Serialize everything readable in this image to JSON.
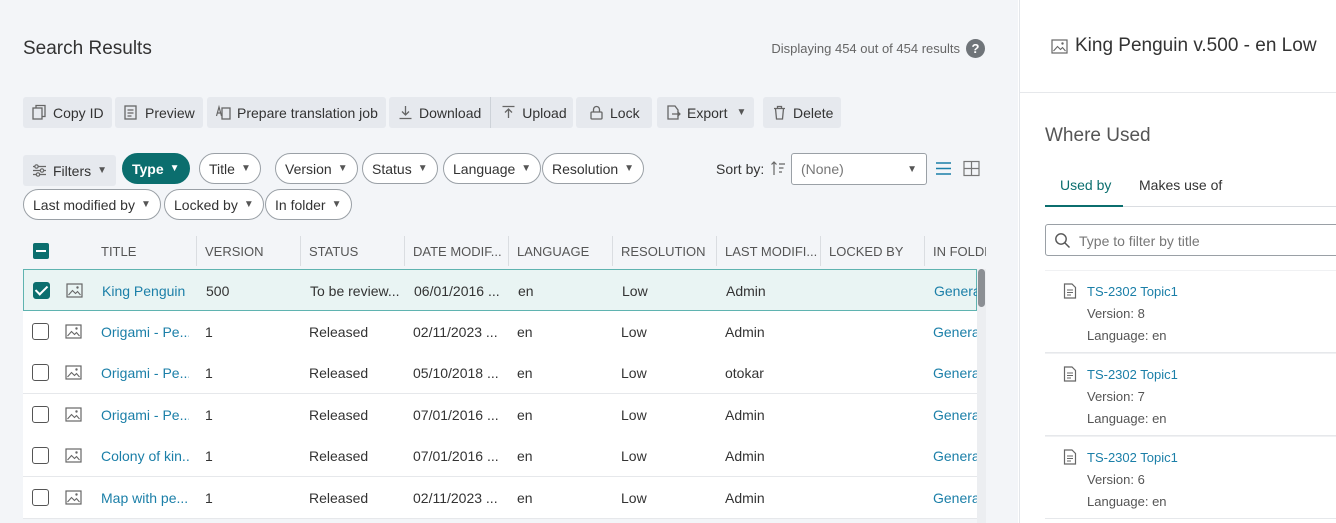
{
  "search": {
    "title": "Search Results",
    "displaying": "Displaying 454 out of 454 results",
    "help": "?"
  },
  "toolbar": {
    "copy_id": "Copy ID",
    "preview": "Preview",
    "prepare_translation": "Prepare translation job",
    "download": "Download",
    "upload": "Upload",
    "lock": "Lock",
    "export": "Export",
    "delete": "Delete"
  },
  "filters": {
    "filters_label": "Filters",
    "chips": [
      "Type",
      "Title",
      "Version",
      "Status",
      "Language",
      "Resolution",
      "Last modified by",
      "Locked by",
      "In folder"
    ],
    "sort_label": "Sort by:",
    "sort_value": "(None)"
  },
  "table": {
    "columns": [
      "TITLE",
      "VERSION",
      "STATUS",
      "DATE MODIF...",
      "LANGUAGE",
      "RESOLUTION",
      "LAST MODIFI...",
      "LOCKED BY",
      "IN FOLDE"
    ],
    "rows": [
      {
        "title": "King Penguin",
        "version": "500",
        "status": "To be review...",
        "date": "06/01/2016 ...",
        "language": "en",
        "resolution": "Low",
        "modified_by": "Admin",
        "locked_by": "",
        "folder": "Genera",
        "checked": true
      },
      {
        "title": "Origami - Pe...",
        "version": "1",
        "status": "Released",
        "date": "02/11/2023 ...",
        "language": "en",
        "resolution": "Low",
        "modified_by": "Admin",
        "locked_by": "",
        "folder": "Genera",
        "checked": false
      },
      {
        "title": "Origami - Pe...",
        "version": "1",
        "status": "Released",
        "date": "05/10/2018 ...",
        "language": "en",
        "resolution": "Low",
        "modified_by": "otokar",
        "locked_by": "",
        "folder": "Genera",
        "checked": false
      },
      {
        "title": "Origami - Pe...",
        "version": "1",
        "status": "Released",
        "date": "07/01/2016 ...",
        "language": "en",
        "resolution": "Low",
        "modified_by": "Admin",
        "locked_by": "",
        "folder": "Genera",
        "checked": false
      },
      {
        "title": "Colony of kin...",
        "version": "1",
        "status": "Released",
        "date": "07/01/2016 ...",
        "language": "en",
        "resolution": "Low",
        "modified_by": "Admin",
        "locked_by": "",
        "folder": "Genera",
        "checked": false
      },
      {
        "title": "Map with pe...",
        "version": "1",
        "status": "Released",
        "date": "02/11/2023 ...",
        "language": "en",
        "resolution": "Low",
        "modified_by": "Admin",
        "locked_by": "",
        "folder": "Genera",
        "checked": false
      }
    ]
  },
  "panel": {
    "title": "King Penguin v.500 - en Low",
    "where_used": "Where Used",
    "tabs": [
      "Used by",
      "Makes use of"
    ],
    "filter_placeholder": "Type to filter by title",
    "refs": [
      {
        "name": "TS-2302 Topic1",
        "version": "Version: 8",
        "language": "Language: en"
      },
      {
        "name": "TS-2302 Topic1",
        "version": "Version: 7",
        "language": "Language: en"
      },
      {
        "name": "TS-2302 Topic1",
        "version": "Version: 6",
        "language": "Language: en"
      }
    ]
  },
  "colors": {
    "accent": "#0b6e6e",
    "link": "#1b7fa8"
  }
}
